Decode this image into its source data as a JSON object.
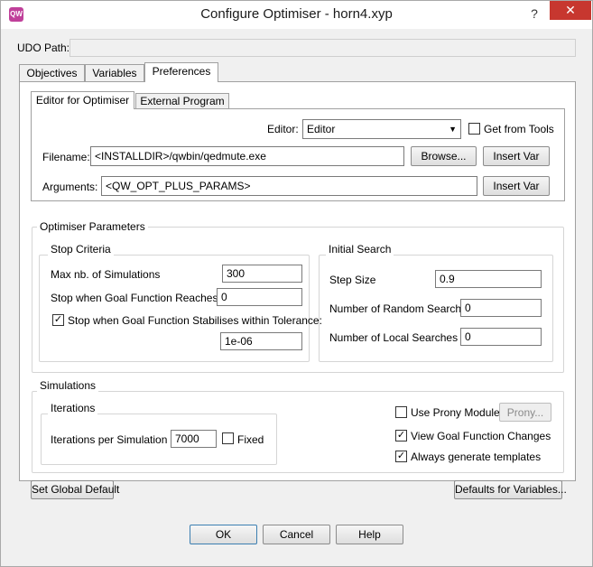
{
  "window": {
    "title": "Configure Optimiser - horn4.xyp",
    "app_icon_text": "QW",
    "help_glyph": "?",
    "close_glyph": "✕"
  },
  "udo_path": {
    "label": "UDO Path:",
    "value": ""
  },
  "tabs": [
    {
      "label": "Objectives",
      "active": false
    },
    {
      "label": "Variables",
      "active": false
    },
    {
      "label": "Preferences",
      "active": true
    }
  ],
  "editor_tabs": [
    {
      "label": "Editor for Optimiser",
      "active": true
    },
    {
      "label": "External Program",
      "active": false
    }
  ],
  "editor": {
    "editor_label": "Editor:",
    "editor_value": "Editor",
    "get_from_tools_label": "Get from Tools",
    "get_from_tools_checked": false,
    "filename_label": "Filename:",
    "filename_value": "<INSTALLDIR>/qwbin/qedmute.exe",
    "browse_label": "Browse...",
    "insert_var_label": "Insert Var",
    "arguments_label": "Arguments:",
    "arguments_value": "<QW_OPT_PLUS_PARAMS>"
  },
  "optimiser_parameters": {
    "title": "Optimiser Parameters",
    "stop_criteria": {
      "title": "Stop Criteria",
      "max_sims_label": "Max nb. of Simulations",
      "max_sims_value": "300",
      "goal_reaches_label": "Stop when Goal Function Reaches",
      "goal_reaches_value": "0",
      "stabilises_label": "Stop when Goal Function Stabilises within Tolerance:",
      "stabilises_checked": true,
      "tolerance_value": "1e-06"
    },
    "initial_search": {
      "title": "Initial Search",
      "step_size_label": "Step Size",
      "step_size_value": "0.9",
      "random_label": "Number of Random Searches",
      "random_value": "0",
      "local_label": "Number of Local Searches",
      "local_value": "0"
    }
  },
  "simulations": {
    "title": "Simulations",
    "iterations": {
      "title": "Iterations",
      "per_sim_label": "Iterations per Simulation",
      "per_sim_value": "7000",
      "fixed_label": "Fixed",
      "fixed_checked": false
    },
    "use_prony_label": "Use Prony Module",
    "use_prony_checked": false,
    "prony_button_label": "Prony...",
    "view_goal_label": "View Goal Function Changes",
    "view_goal_checked": true,
    "always_templates_label": "Always generate templates",
    "always_templates_checked": true
  },
  "bottom": {
    "set_global_default_label": "Set Global Default",
    "defaults_for_variables_label": "Defaults for Variables...",
    "ok_label": "OK",
    "cancel_label": "Cancel",
    "help_label": "Help"
  },
  "check_glyph": "✓"
}
